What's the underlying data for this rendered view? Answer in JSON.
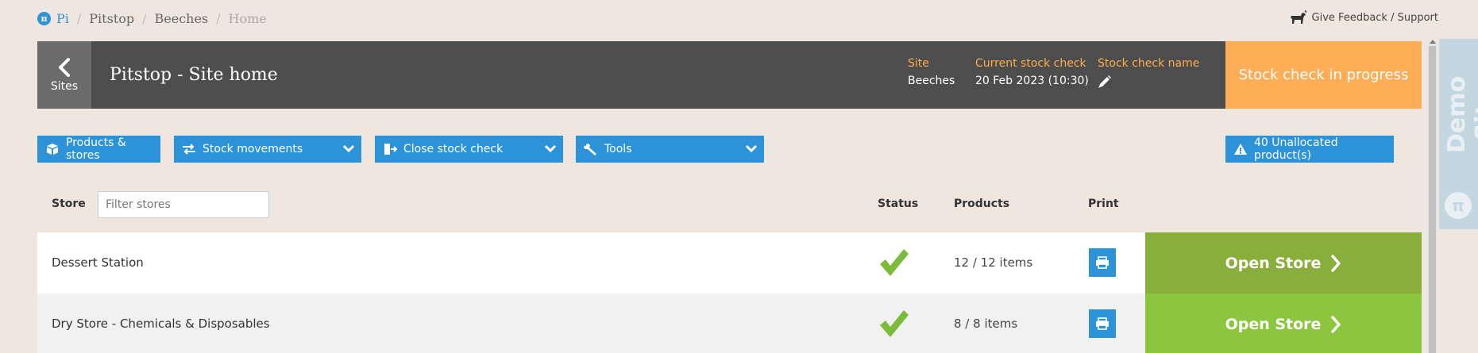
{
  "breadcrumb": {
    "root_icon": "pi-logo-icon",
    "root": "Pi",
    "items": [
      "Pitstop",
      "Beeches"
    ],
    "current": "Home",
    "separator": "/"
  },
  "feedback": {
    "label": "Give Feedback / Support",
    "icon": "dog-icon"
  },
  "header": {
    "back_label": "Sites",
    "title": "Pitstop - Site home",
    "site_label": "Site",
    "site_value": "Beeches",
    "check_label": "Current stock check",
    "check_value": "20 Feb 2023 (10:30)",
    "name_label": "Stock check name",
    "status": "Stock check in progress"
  },
  "toolbar": {
    "products_stores": "Products & stores",
    "stock_movements": "Stock movements",
    "close_stock_check": "Close stock check",
    "tools": "Tools",
    "unallocated": "40 Unallocated product(s)"
  },
  "side_tab": {
    "label": "Demo Site",
    "icon": "π"
  },
  "table": {
    "headers": {
      "store": "Store",
      "status": "Status",
      "products": "Products",
      "print": "Print"
    },
    "filter_placeholder": "Filter stores",
    "rows": [
      {
        "name": "Dessert Station",
        "count": "12 / 12 items",
        "action": "Open Store"
      },
      {
        "name": "Dry Store - Chemicals & Disposables",
        "count": "8 / 8 items",
        "action": "Open Store"
      }
    ]
  },
  "colors": {
    "accent_blue": "#2d93d9",
    "header_dark": "#4d4d4d",
    "status_orange": "#ffad57",
    "green_dark": "#8aae3c",
    "green_light": "#8cc63f",
    "check_green": "#7dbb3a"
  }
}
